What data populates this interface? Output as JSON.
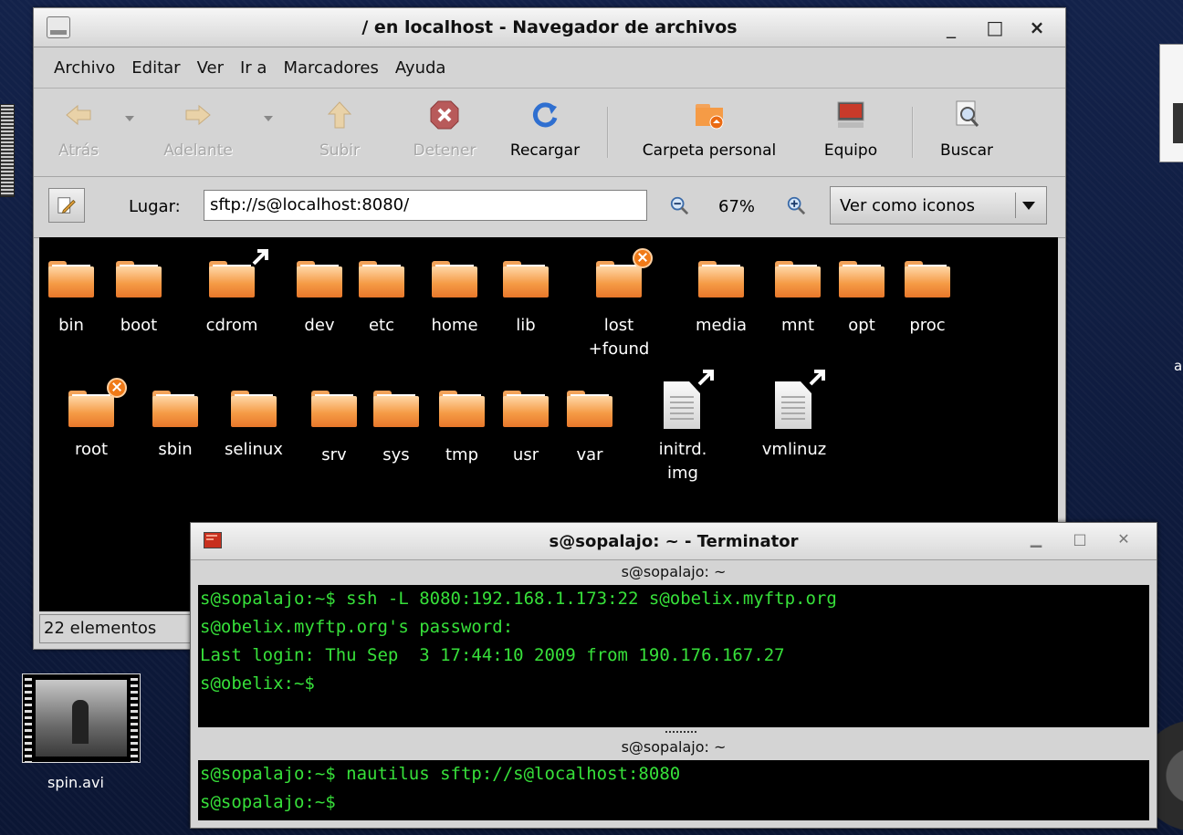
{
  "nautilus": {
    "title": "/ en localhost - Navegador de archivos",
    "window_controls": [
      "_",
      "□",
      "×"
    ],
    "menu": [
      "Archivo",
      "Editar",
      "Ver",
      "Ir a",
      "Marcadores",
      "Ayuda"
    ],
    "toolbar": {
      "back": "Atrás",
      "forward": "Adelante",
      "up": "Subir",
      "stop": "Detener",
      "reload": "Recargar",
      "home": "Carpeta personal",
      "computer": "Equipo",
      "search": "Buscar"
    },
    "location": {
      "label": "Lugar:",
      "value": "sftp://s@localhost:8080/",
      "zoom": "67%",
      "view_mode": "Ver como iconos"
    },
    "items": [
      {
        "name": "bin",
        "kind": "folder"
      },
      {
        "name": "boot",
        "kind": "folder"
      },
      {
        "name": "cdrom",
        "kind": "folder-link"
      },
      {
        "name": "dev",
        "kind": "folder"
      },
      {
        "name": "etc",
        "kind": "folder"
      },
      {
        "name": "home",
        "kind": "folder"
      },
      {
        "name": "lib",
        "kind": "folder"
      },
      {
        "name": "lost",
        "name2": "+found",
        "kind": "folder-restricted"
      },
      {
        "name": "media",
        "kind": "folder"
      },
      {
        "name": "mnt",
        "kind": "folder"
      },
      {
        "name": "opt",
        "kind": "folder"
      },
      {
        "name": "proc",
        "kind": "folder"
      },
      {
        "name": "root",
        "kind": "folder-restricted"
      },
      {
        "name": "sbin",
        "kind": "folder"
      },
      {
        "name": "selinux",
        "kind": "folder"
      },
      {
        "name": "srv",
        "kind": "folder"
      },
      {
        "name": "sys",
        "kind": "folder"
      },
      {
        "name": "tmp",
        "kind": "folder"
      },
      {
        "name": "usr",
        "kind": "folder"
      },
      {
        "name": "var",
        "kind": "folder"
      },
      {
        "name": "initrd.",
        "name2": "img",
        "kind": "file-link"
      },
      {
        "name": "vmlinuz",
        "kind": "file-link"
      }
    ],
    "status": "22 elementos"
  },
  "terminal": {
    "title": "s@sopalajo: ~ - Terminator",
    "pane1_title": "s@sopalajo: ~",
    "pane1_lines": [
      "s@sopalajo:~$ ssh -L 8080:192.168.1.173:22 s@obelix.myftp.org",
      "s@obelix.myftp.org's password:",
      "Last login: Thu Sep  3 17:44:10 2009 from 190.176.167.27",
      "s@obelix:~$"
    ],
    "pane2_title": "s@sopalajo: ~",
    "pane2_lines": [
      "s@sopalajo:~$ nautilus sftp://s@localhost:8080",
      "s@sopalajo:~$"
    ],
    "text_color": "#37e03a"
  },
  "desktop": {
    "video_file": "spin.avi",
    "edge_text": "a"
  }
}
